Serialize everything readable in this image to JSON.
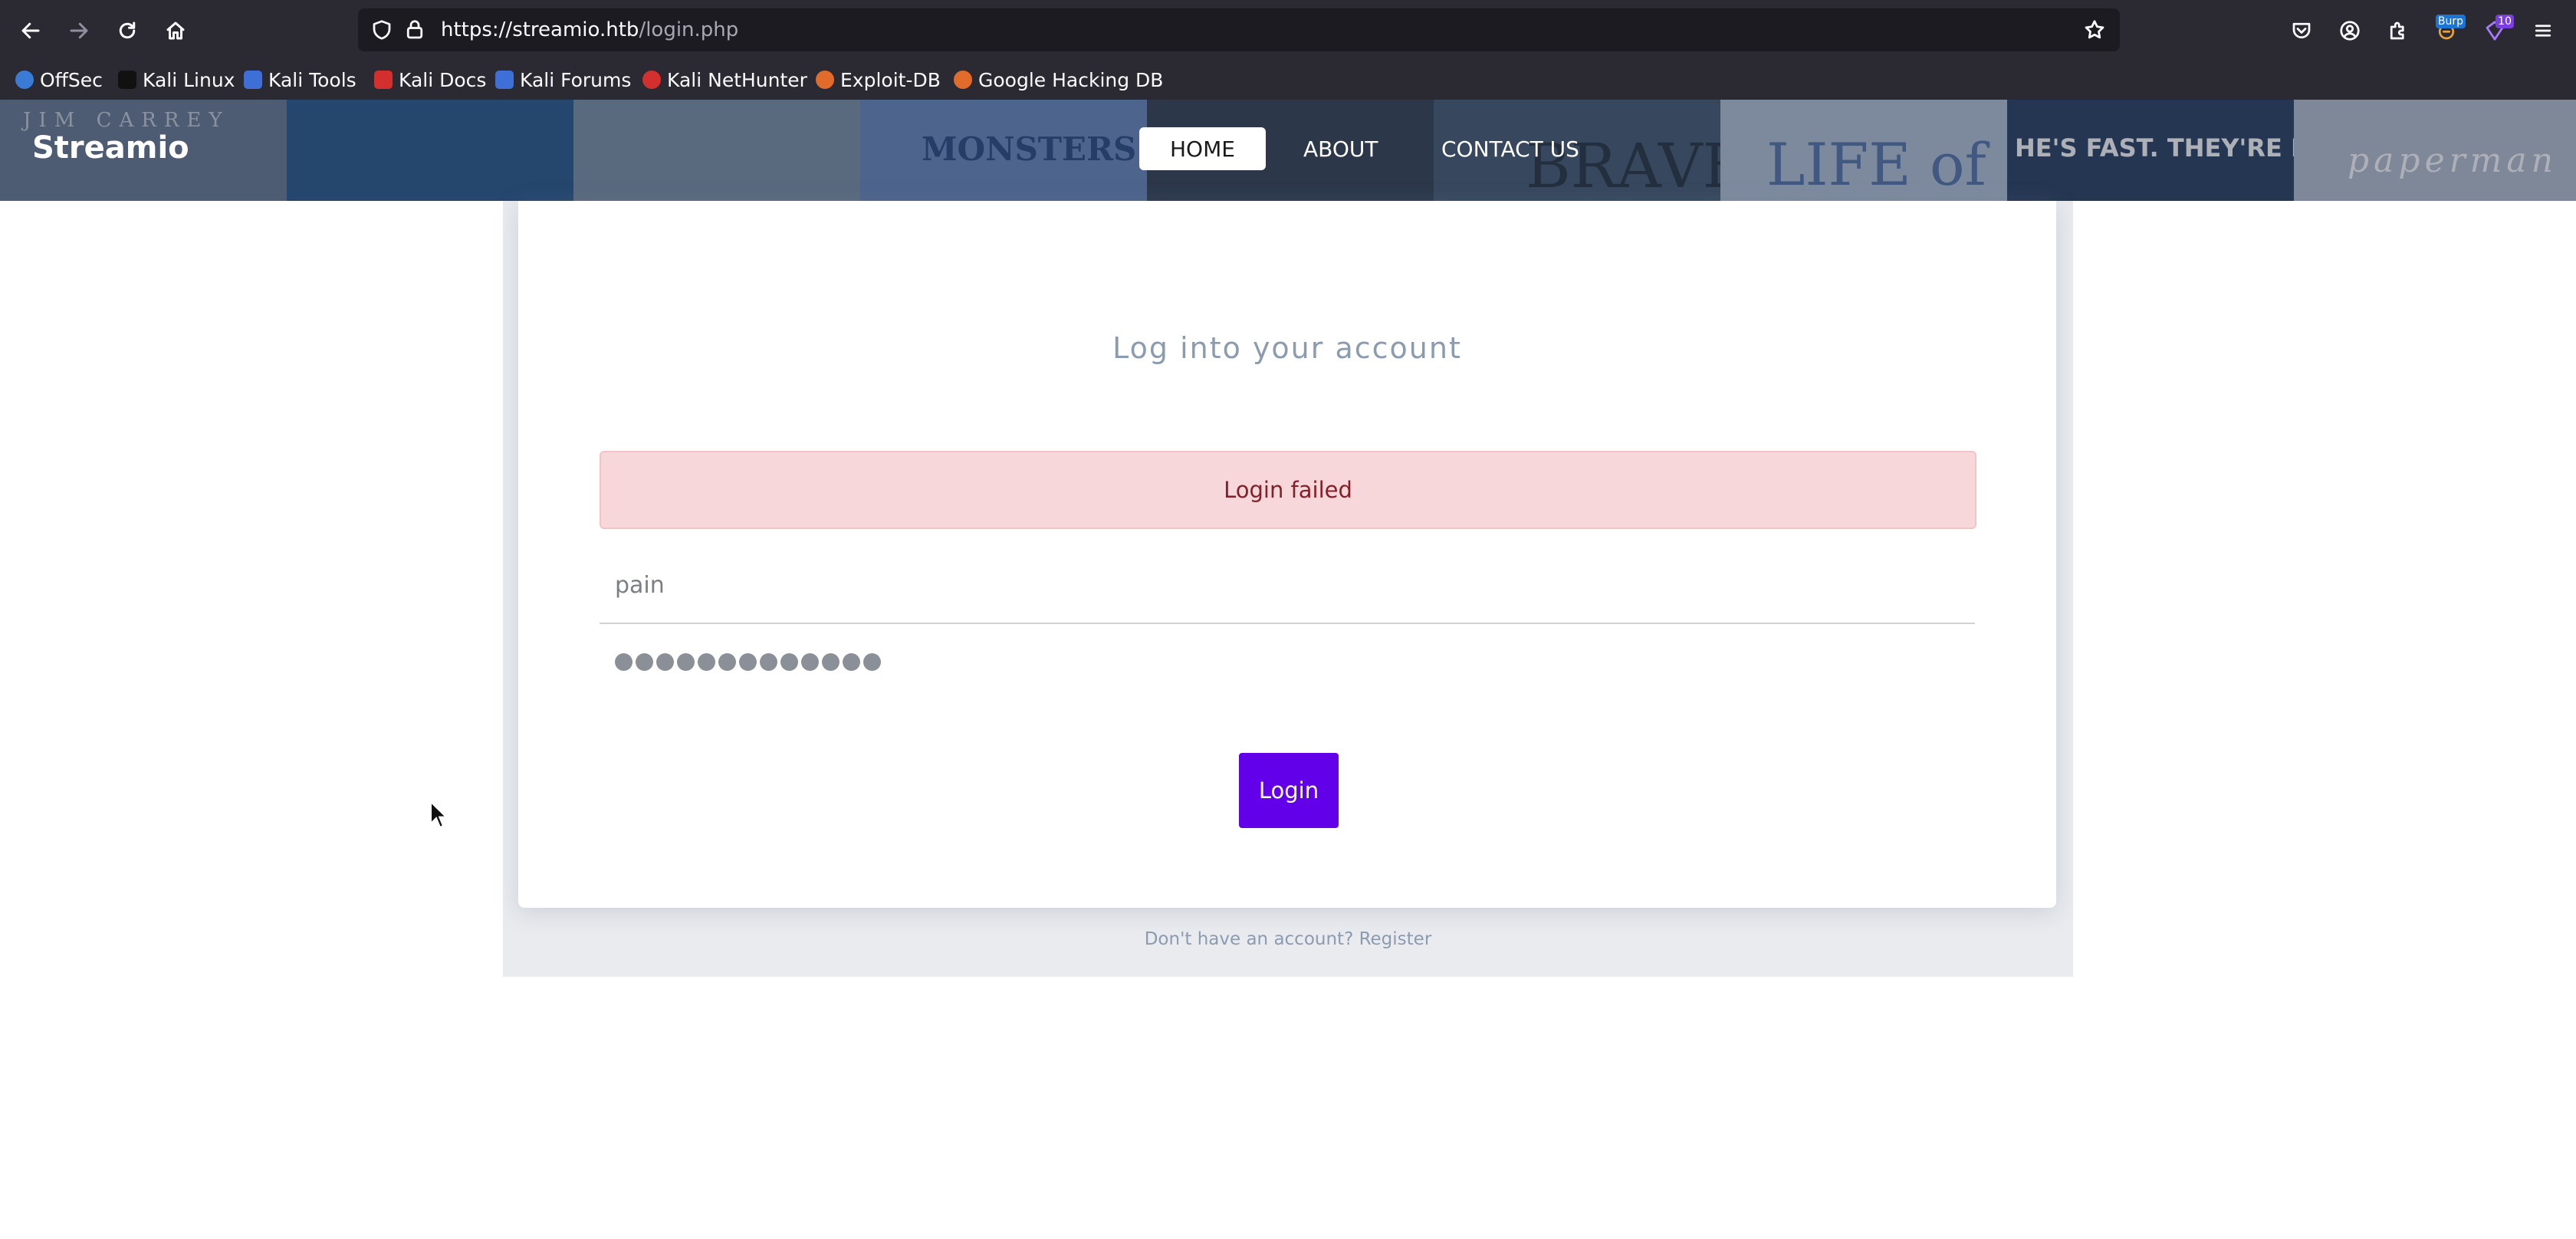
{
  "browser": {
    "url_host": "https://streamio.htb",
    "url_path": "/login.php",
    "extension_badge_1": "Burp",
    "extension_badge_2": "10",
    "bookmarks": [
      {
        "label": "OffSec",
        "color": "#3a7bd5"
      },
      {
        "label": "Kali Linux",
        "color": "#2b2a33"
      },
      {
        "label": "Kali Tools",
        "color": "#3d6fd6"
      },
      {
        "label": "Kali Docs",
        "color": "#d32f2f"
      },
      {
        "label": "Kali Forums",
        "color": "#3d6fd6"
      },
      {
        "label": "Kali NetHunter",
        "color": "#d32f2f"
      },
      {
        "label": "Exploit-DB",
        "color": "#e06b2a"
      },
      {
        "label": "Google Hacking DB",
        "color": "#e06b2a"
      }
    ]
  },
  "header": {
    "brand": "Streamio",
    "nav": [
      {
        "label": "HOME",
        "active": true
      },
      {
        "label": "ABOUT",
        "active": false
      },
      {
        "label": "CONTACT US",
        "active": false
      }
    ],
    "posters": [
      {
        "text": "JIM CARREY",
        "color": "#7e8fa8"
      },
      {
        "text": "",
        "color": "#3f6fa6"
      },
      {
        "text": "",
        "color": "#8aa0b8"
      },
      {
        "text": "MONSTERS",
        "color": "#6f8fc4"
      },
      {
        "text": "",
        "color": "#3c4a5e"
      },
      {
        "text": "BRAVE",
        "color": "#4a5f78"
      },
      {
        "text": "LIFE of PI",
        "color": "#9fb3cf"
      },
      {
        "text": "HE'S FAST. THEY'RE FURIOUS.",
        "color": "#3b4e6c"
      },
      {
        "text": "paperman",
        "color": "#aeb8c8"
      }
    ]
  },
  "login": {
    "title": "Log into your account",
    "alert": "Login failed",
    "username_value": "pain",
    "password_length": 13,
    "submit_label": "Login",
    "register_prompt": "Don't have an account? Register"
  },
  "colors": {
    "accent": "#6200ea",
    "alert_bg": "#f8d7da",
    "alert_text": "#842029"
  }
}
